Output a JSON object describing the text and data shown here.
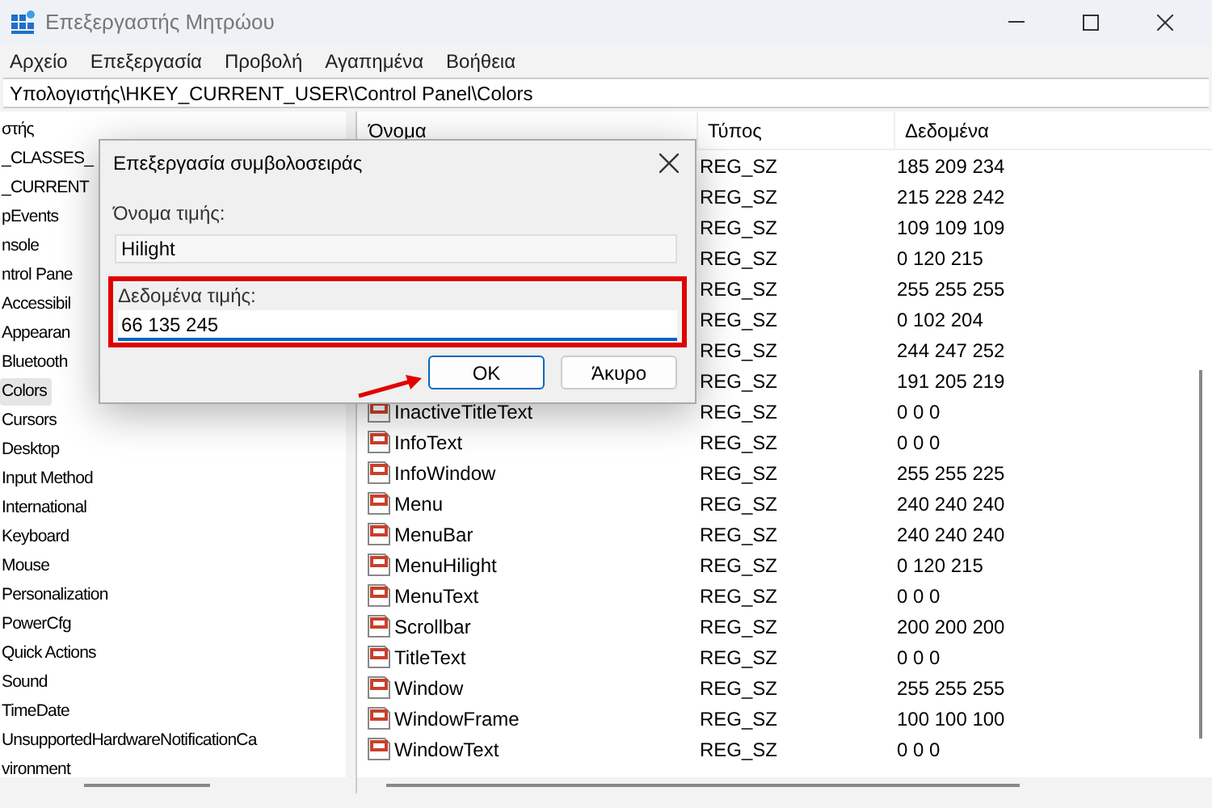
{
  "window": {
    "title": "Επεξεργαστής Μητρώου"
  },
  "menu": [
    "Αρχείο",
    "Επεξεργασία",
    "Προβολή",
    "Αγαπημένα",
    "Βοήθεια"
  ],
  "address": "Υπολογιστής\\HKEY_CURRENT_USER\\Control Panel\\Colors",
  "tree": [
    {
      "label": "στής",
      "selected": false
    },
    {
      "label": "_CLASSES_",
      "selected": false
    },
    {
      "label": "_CURRENT",
      "selected": false
    },
    {
      "label": "pEvents",
      "selected": false
    },
    {
      "label": "nsole",
      "selected": false
    },
    {
      "label": "ntrol Pane",
      "selected": false
    },
    {
      "label": "Accessibil",
      "selected": false
    },
    {
      "label": "Appearan",
      "selected": false
    },
    {
      "label": "Bluetooth",
      "selected": false
    },
    {
      "label": "Colors",
      "selected": true
    },
    {
      "label": "Cursors",
      "selected": false
    },
    {
      "label": "Desktop",
      "selected": false
    },
    {
      "label": "Input Method",
      "selected": false
    },
    {
      "label": "International",
      "selected": false
    },
    {
      "label": "Keyboard",
      "selected": false
    },
    {
      "label": "Mouse",
      "selected": false
    },
    {
      "label": "Personalization",
      "selected": false
    },
    {
      "label": "PowerCfg",
      "selected": false
    },
    {
      "label": "Quick Actions",
      "selected": false
    },
    {
      "label": "Sound",
      "selected": false
    },
    {
      "label": "TimeDate",
      "selected": false
    },
    {
      "label": "UnsupportedHardwareNotificationCa",
      "selected": false
    },
    {
      "label": "vironment",
      "selected": false
    }
  ],
  "table": {
    "columns": [
      "Όνομα",
      "Τύπος",
      "Δεδομένα"
    ],
    "rows": [
      {
        "type": "REG_SZ",
        "data": "185 209 234"
      },
      {
        "type": "REG_SZ",
        "data": "215 228 242"
      },
      {
        "type": "REG_SZ",
        "data": "109 109 109"
      },
      {
        "type": "REG_SZ",
        "data": "0 120 215"
      },
      {
        "type": "REG_SZ",
        "data": "255 255 255"
      },
      {
        "type": "REG_SZ",
        "data": "0 102 204"
      },
      {
        "type": "REG_SZ",
        "data": "244 247 252"
      },
      {
        "type": "REG_SZ",
        "data": "191 205 219"
      },
      {
        "name": "InactiveTitleText",
        "type": "REG_SZ",
        "data": "0 0 0"
      },
      {
        "name": "InfoText",
        "type": "REG_SZ",
        "data": "0 0 0"
      },
      {
        "name": "InfoWindow",
        "type": "REG_SZ",
        "data": "255 255 225"
      },
      {
        "name": "Menu",
        "type": "REG_SZ",
        "data": "240 240 240"
      },
      {
        "name": "MenuBar",
        "type": "REG_SZ",
        "data": "240 240 240"
      },
      {
        "name": "MenuHilight",
        "type": "REG_SZ",
        "data": "0 120 215"
      },
      {
        "name": "MenuText",
        "type": "REG_SZ",
        "data": "0 0 0"
      },
      {
        "name": "Scrollbar",
        "type": "REG_SZ",
        "data": "200 200 200"
      },
      {
        "name": "TitleText",
        "type": "REG_SZ",
        "data": "0 0 0"
      },
      {
        "name": "Window",
        "type": "REG_SZ",
        "data": "255 255 255"
      },
      {
        "name": "WindowFrame",
        "type": "REG_SZ",
        "data": "100 100 100"
      },
      {
        "name": "WindowText",
        "type": "REG_SZ",
        "data": "0 0 0"
      }
    ]
  },
  "dialog": {
    "title": "Επεξεργασία συμβολοσειράς",
    "name_label": "Όνομα τιμής:",
    "name_value": "Hilight",
    "data_label": "Δεδομένα τιμής:",
    "data_value": "66 135 245",
    "buttons": [
      "OK",
      "Άκυρο"
    ]
  }
}
